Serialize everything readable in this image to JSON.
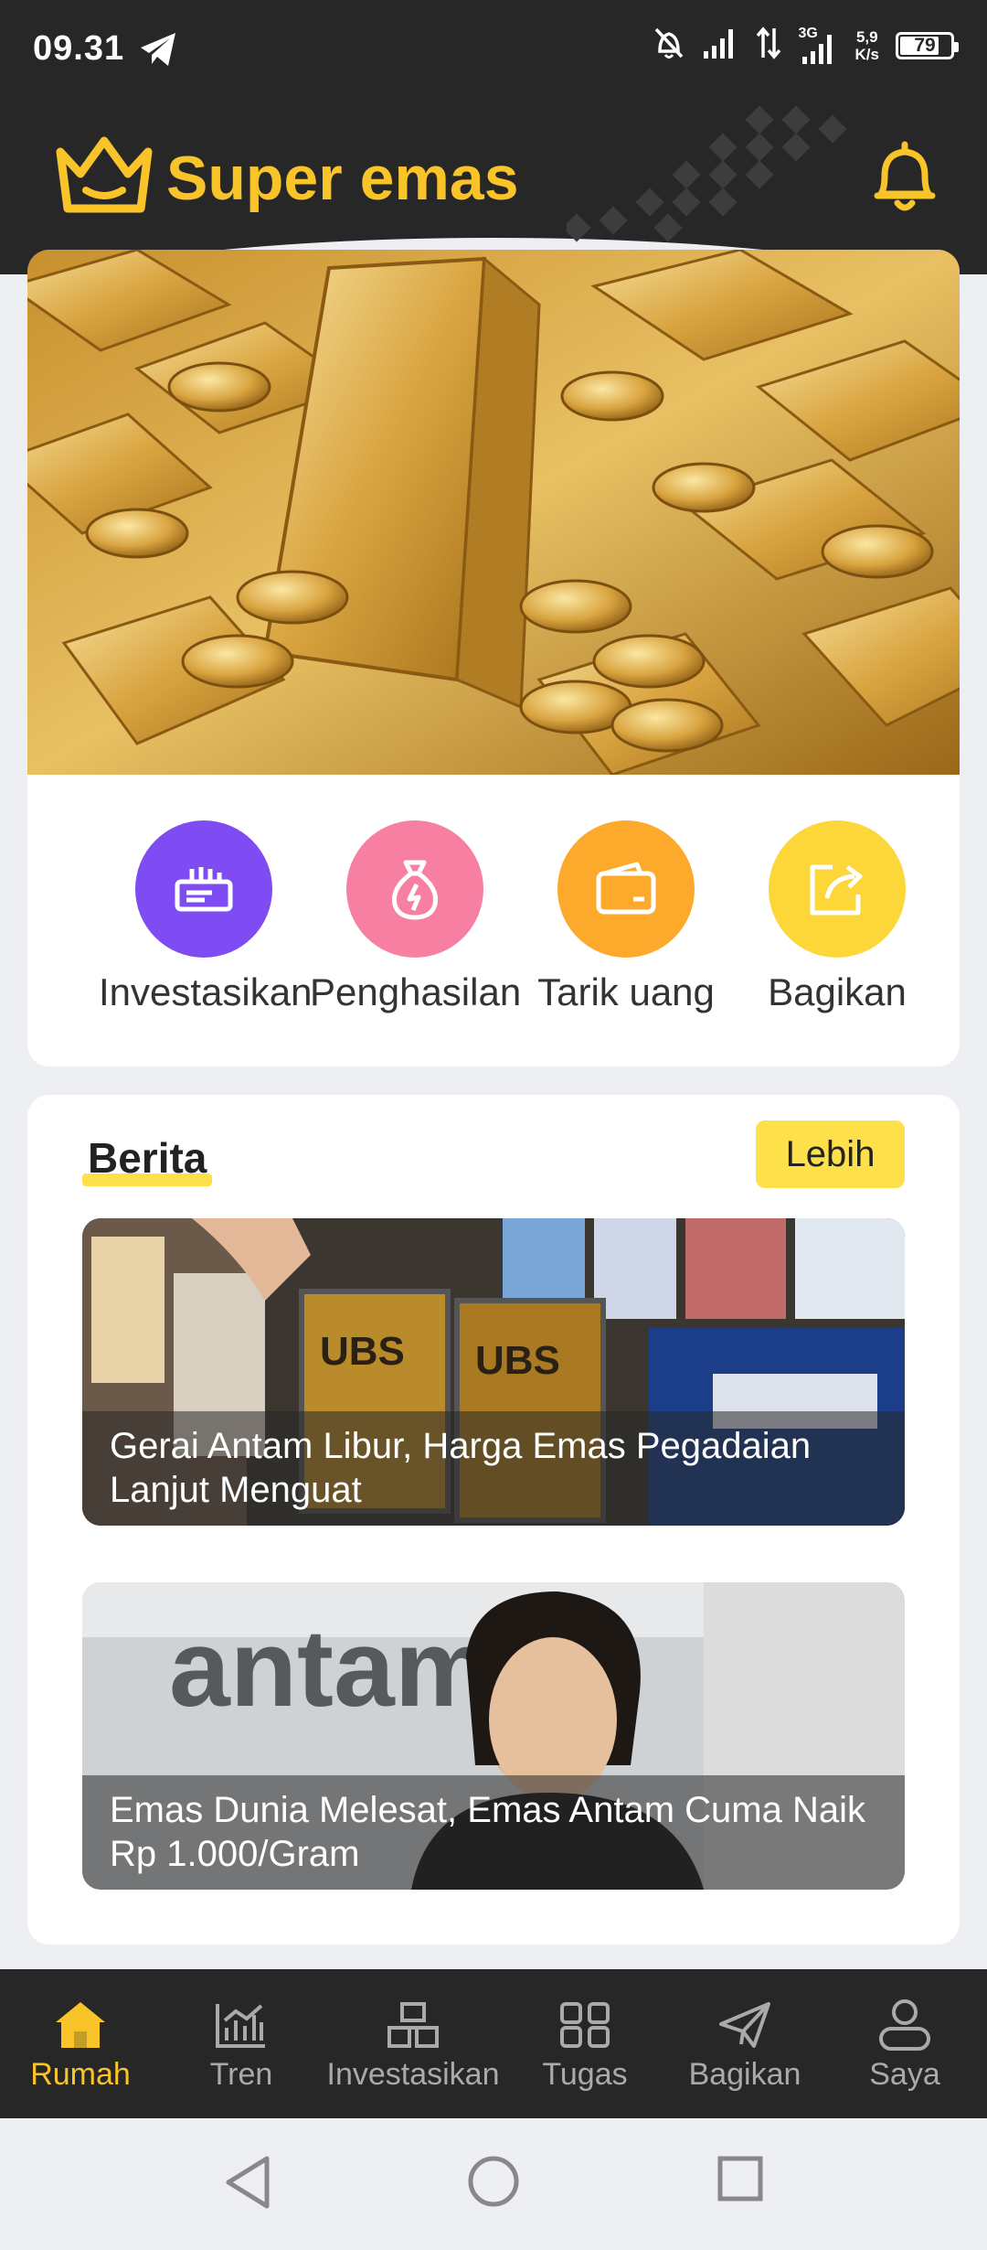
{
  "status": {
    "time": "09.31",
    "net": "3G",
    "speed_top": "5,9",
    "speed_bottom": "K/s",
    "battery": "79",
    "battery_level": 0.79
  },
  "header": {
    "app_name": "Super emas"
  },
  "quick_actions": [
    {
      "label": "Investasikan",
      "icon": "invest-icon",
      "color": "#7e4cf2"
    },
    {
      "label": "Penghasilan",
      "icon": "money-bag-icon",
      "color": "#f77fa2"
    },
    {
      "label": "Tarik uang",
      "icon": "wallet-icon",
      "color": "#fdaa2c"
    },
    {
      "label": "Bagikan",
      "icon": "share-icon",
      "color": "#fdd63a"
    }
  ],
  "news": {
    "title": "Berita",
    "more_label": "Lebih",
    "items": [
      {
        "caption": "Gerai Antam Libur, Harga Emas Pegadaian Lanjut Menguat"
      },
      {
        "caption": "Emas Dunia Melesat, Emas Antam Cuma Naik Rp 1.000/Gram"
      }
    ]
  },
  "bottom_nav": [
    {
      "label": "Rumah",
      "icon": "home-icon",
      "active": true
    },
    {
      "label": "Tren",
      "icon": "chart-icon",
      "active": false
    },
    {
      "label": "Investasikan",
      "icon": "invest-boxes-icon",
      "active": false
    },
    {
      "label": "Tugas",
      "icon": "grid-icon",
      "active": false
    },
    {
      "label": "Bagikan",
      "icon": "send-icon",
      "active": false
    },
    {
      "label": "Saya",
      "icon": "user-icon",
      "active": false
    }
  ],
  "colors": {
    "accent": "#f8c42a",
    "dark": "#272727",
    "highlight": "#fde04a"
  }
}
